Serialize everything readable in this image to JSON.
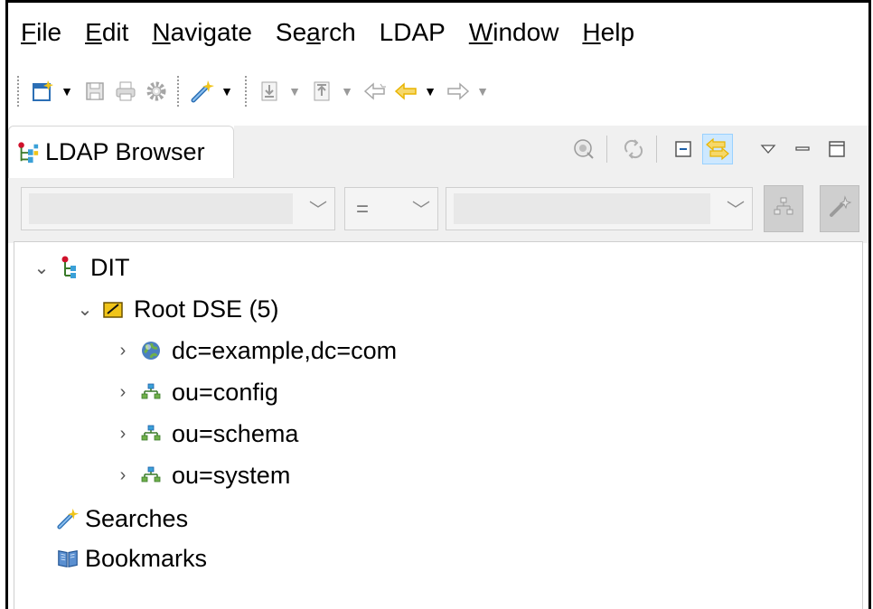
{
  "menubar": {
    "items": [
      {
        "pre": "",
        "mn": "F",
        "post": "ile"
      },
      {
        "pre": "",
        "mn": "E",
        "post": "dit"
      },
      {
        "pre": "",
        "mn": "N",
        "post": "avigate"
      },
      {
        "pre": "Se",
        "mn": "a",
        "post": "rch"
      },
      {
        "pre": "LDAP",
        "mn": "",
        "post": ""
      },
      {
        "pre": "",
        "mn": "W",
        "post": "indow"
      },
      {
        "pre": "",
        "mn": "H",
        "post": "elp"
      }
    ]
  },
  "toolbar": {
    "icons": [
      "new-icon",
      "save-icon",
      "print-icon",
      "gear-icon",
      "search-wand-icon",
      "import-icon",
      "export-icon",
      "back-history-icon",
      "back-arrow-icon",
      "forward-arrow-icon"
    ]
  },
  "view": {
    "tab_label": "LDAP Browser",
    "actions": [
      "connect-icon",
      "refresh-icon",
      "collapse-all-icon",
      "link-with-editor-icon",
      "view-menu-icon",
      "minimize-icon",
      "maximize-icon"
    ]
  },
  "quicksearch": {
    "operator": "=",
    "attribute_value": "",
    "filter_value": ""
  },
  "tree": {
    "dit": "DIT",
    "root_dse": "Root DSE (5)",
    "entries": [
      "dc=example,dc=com",
      "ou=config",
      "ou=schema",
      "ou=system"
    ],
    "searches": "Searches",
    "bookmarks": "Bookmarks"
  },
  "colors": {
    "accent_on": "#cde8ff",
    "arrow_yellow": "#e8b400",
    "folder_yellow": "#f0c419"
  }
}
